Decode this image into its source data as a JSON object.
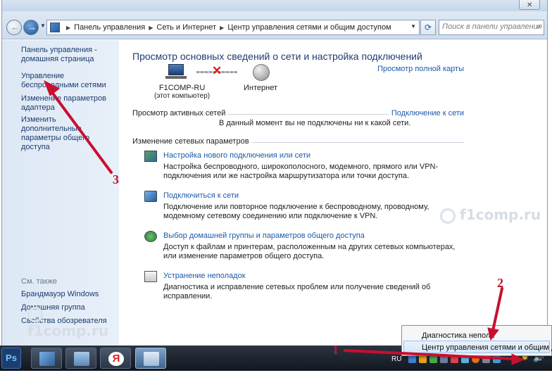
{
  "address": {
    "crumbs": [
      "Панель управления",
      "Сеть и Интернет",
      "Центр управления сетями и общим доступом"
    ],
    "search_placeholder": "Поиск в панели управления"
  },
  "sidebar": {
    "items": [
      "Панель управления - домашняя страница",
      "Управление беспроводными сетями",
      "Изменение параметров адаптера",
      "Изменить дополнительные параметры общего доступа"
    ],
    "see_also_label": "См. также",
    "see_also": [
      "Брандмауэр Windows",
      "Домашняя группа",
      "Свойства обозревателя"
    ]
  },
  "main": {
    "title": "Просмотр основных сведений о сети и настройка подключений",
    "full_map": "Просмотр полной карты",
    "computer_name": "F1COMP-RU",
    "computer_sub": "(этот компьютер)",
    "internet": "Интернет",
    "active_networks": "Просмотр активных сетей",
    "connect_to_network": "Подключение к сети",
    "not_connected": "В данный момент вы не подключены ни к какой сети.",
    "change_settings": "Изменение сетевых параметров",
    "tasks": [
      {
        "link": "Настройка нового подключения или сети",
        "desc": "Настройка беспроводного, широкополосного, модемного, прямого или VPN-подключения или же настройка маршрутизатора или точки доступа."
      },
      {
        "link": "Подключиться к сети",
        "desc": "Подключение или повторное подключение к беспроводному, проводному, модемному сетевому соединению или подключение к VPN."
      },
      {
        "link": "Выбор домашней группы и параметров общего доступа",
        "desc": "Доступ к файлам и принтерам, расположенным на других сетевых компьютерах, или изменение параметров общего доступа."
      },
      {
        "link": "Устранение неполадок",
        "desc": "Диагностика и исправление сетевых проблем или получение сведений об исправлении."
      }
    ]
  },
  "watermark": "f1comp.ru",
  "sidebar_watermark": "f1comp.ru",
  "context_menu": {
    "items": [
      "Диагностика непола",
      "Центр управления сетями и общим до"
    ]
  },
  "taskbar": {
    "ps_label": "Ps",
    "yandex_label": "Я",
    "lang": "RU"
  },
  "annotations": [
    "1",
    "2",
    "3"
  ],
  "colors": {
    "link": "#1c5aa8",
    "annotation": "#c8102e",
    "sidebar": "#dde8f5"
  }
}
